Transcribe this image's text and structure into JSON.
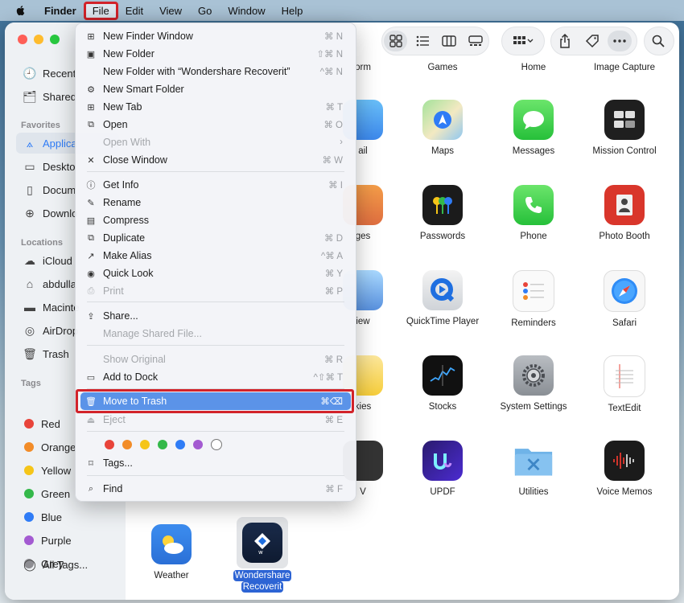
{
  "menubar": {
    "app_name": "Finder",
    "items": [
      "File",
      "Edit",
      "View",
      "Go",
      "Window",
      "Help"
    ]
  },
  "sidebar": {
    "items_top": [
      "Recent",
      "Shared"
    ],
    "favorites_header": "Favorites",
    "favorites": [
      "Applica",
      "Deskto",
      "Docum",
      "Downlo"
    ],
    "locations_header": "Locations",
    "locations": [
      "iCloud",
      "abdulla",
      "Macinte",
      "AirDrop",
      "Trash"
    ],
    "tags_header": "Tags",
    "tags": [
      {
        "label": "Red",
        "color": "#e8443a"
      },
      {
        "label": "Orange",
        "color": "#f28c28"
      },
      {
        "label": "Yellow",
        "color": "#f5c518"
      },
      {
        "label": "Green",
        "color": "#34b84a"
      },
      {
        "label": "Blue",
        "color": "#2f7cf6"
      },
      {
        "label": "Purple",
        "color": "#a35ad1"
      },
      {
        "label": "Grey",
        "color": "#8e8e93"
      }
    ],
    "all_tags": "All Tags..."
  },
  "apps": {
    "row0": [
      "orm",
      "Games",
      "Home",
      "Image Capture"
    ],
    "row1": [
      "ail",
      "Maps",
      "Messages",
      "Mission Control"
    ],
    "row2": [
      "ges",
      "Passwords",
      "Phone",
      "Photo Booth"
    ],
    "row3": [
      "iew",
      "QuickTime Player",
      "Reminders",
      "Safari"
    ],
    "row4": [
      "kies",
      "Stocks",
      "System Settings",
      "TextEdit"
    ],
    "row5": [
      "V",
      "UPDF",
      "Utilities",
      "Voice Memos"
    ],
    "row6_weather": "Weather",
    "row6_selected_line1": "Wondershare",
    "row6_selected_line2": "Recoverit"
  },
  "menu": {
    "items": [
      {
        "label": "New Finder Window",
        "shortcut": "⌘ N"
      },
      {
        "label": "New Folder",
        "shortcut": "⇧⌘ N"
      },
      {
        "label": "New Folder with “Wondershare Recoverit”",
        "shortcut": "^⌘ N"
      },
      {
        "label": "New Smart Folder",
        "shortcut": ""
      },
      {
        "label": "New Tab",
        "shortcut": "⌘ T"
      },
      {
        "label": "Open",
        "shortcut": "⌘ O"
      },
      {
        "label": "Open With",
        "shortcut": "›"
      },
      {
        "label": "Close Window",
        "shortcut": "⌘ W"
      },
      {
        "label": "Get Info",
        "shortcut": "⌘ I"
      },
      {
        "label": "Rename",
        "shortcut": ""
      },
      {
        "label": "Compress",
        "shortcut": ""
      },
      {
        "label": "Duplicate",
        "shortcut": "⌘ D"
      },
      {
        "label": "Make Alias",
        "shortcut": "^⌘ A"
      },
      {
        "label": "Quick Look",
        "shortcut": "⌘ Y"
      },
      {
        "label": "Print",
        "shortcut": "⌘ P"
      },
      {
        "label": "Share...",
        "shortcut": ""
      },
      {
        "label": "Manage Shared File...",
        "shortcut": ""
      },
      {
        "label": "Show Original",
        "shortcut": "⌘ R"
      },
      {
        "label": "Add to Dock",
        "shortcut": "^⇧⌘ T"
      },
      {
        "label": "Move to Trash",
        "shortcut": "⌘⌫"
      },
      {
        "label": "Eject",
        "shortcut": "⌘ E"
      },
      {
        "label": "Tags...",
        "shortcut": ""
      },
      {
        "label": "Find",
        "shortcut": "⌘ F"
      }
    ],
    "tag_colors": [
      "#e8443a",
      "#f28c28",
      "#f5c518",
      "#34b84a",
      "#2f7cf6",
      "#a35ad1",
      "#ffffff"
    ]
  },
  "colors": {
    "accent": "#2f7cf6",
    "highlight": "#5b93e8",
    "annotation": "#d2232a"
  }
}
